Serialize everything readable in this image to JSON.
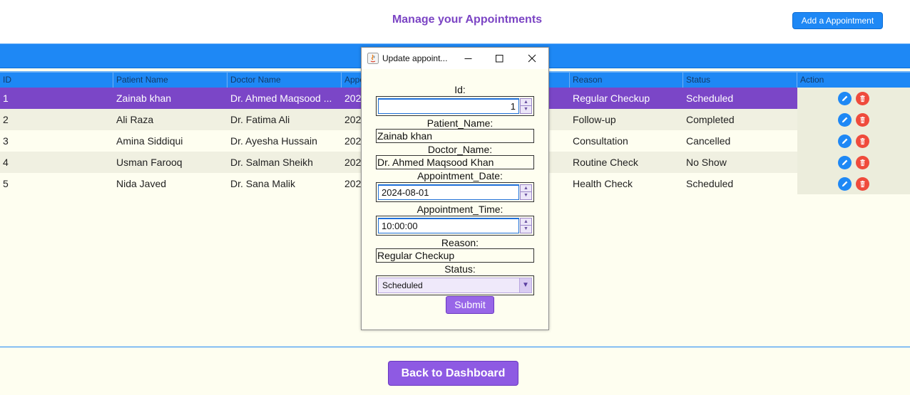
{
  "header": {
    "title": "Manage your Appointments",
    "add_button": "Add a Appointment"
  },
  "table": {
    "columns": [
      "ID",
      "Patient Name",
      "Doctor Name",
      "Appo",
      "Reason",
      "Status",
      "Action"
    ],
    "rows": [
      {
        "id": "1",
        "patient": "Zainab khan",
        "doctor": "Dr. Ahmed Maqsood ...",
        "date": "202",
        "reason": "Regular Checkup",
        "status": "Scheduled"
      },
      {
        "id": "2",
        "patient": "Ali Raza",
        "doctor": "Dr. Fatima Ali",
        "date": "202",
        "reason": "Follow-up",
        "status": "Completed"
      },
      {
        "id": "3",
        "patient": "Amina Siddiqui",
        "doctor": "Dr. Ayesha Hussain",
        "date": "202",
        "reason": "Consultation",
        "status": "Cancelled"
      },
      {
        "id": "4",
        "patient": "Usman Farooq",
        "doctor": "Dr. Salman Sheikh",
        "date": "202",
        "reason": "Routine Check",
        "status": "No Show"
      },
      {
        "id": "5",
        "patient": "Nida Javed",
        "doctor": "Dr. Sana Malik",
        "date": "202",
        "reason": "Health Check",
        "status": "Scheduled"
      }
    ],
    "icons": {
      "edit": "pencil-icon",
      "delete": "trash-icon"
    },
    "colors": {
      "selected_row": "#7b46c7",
      "header": "#1e88f5",
      "edit": "#1e88f5",
      "delete": "#ef4b3c"
    }
  },
  "dialog": {
    "title": "Update appoint...",
    "labels": {
      "id": "Id:",
      "patient_name": "Patient_Name:",
      "doctor_name": "Doctor_Name:",
      "date": "Appointment_Date:",
      "time": "Appointment_Time:",
      "reason": "Reason:",
      "status": "Status:"
    },
    "values": {
      "id": "1",
      "patient_name": "Zainab khan",
      "doctor_name": "Dr. Ahmed Maqsood Khan",
      "date": "2024-08-01",
      "time": "10:00:00",
      "reason": "Regular Checkup",
      "status": "Scheduled"
    },
    "submit": "Submit"
  },
  "footer": {
    "back_button": "Back to Dashboard"
  }
}
